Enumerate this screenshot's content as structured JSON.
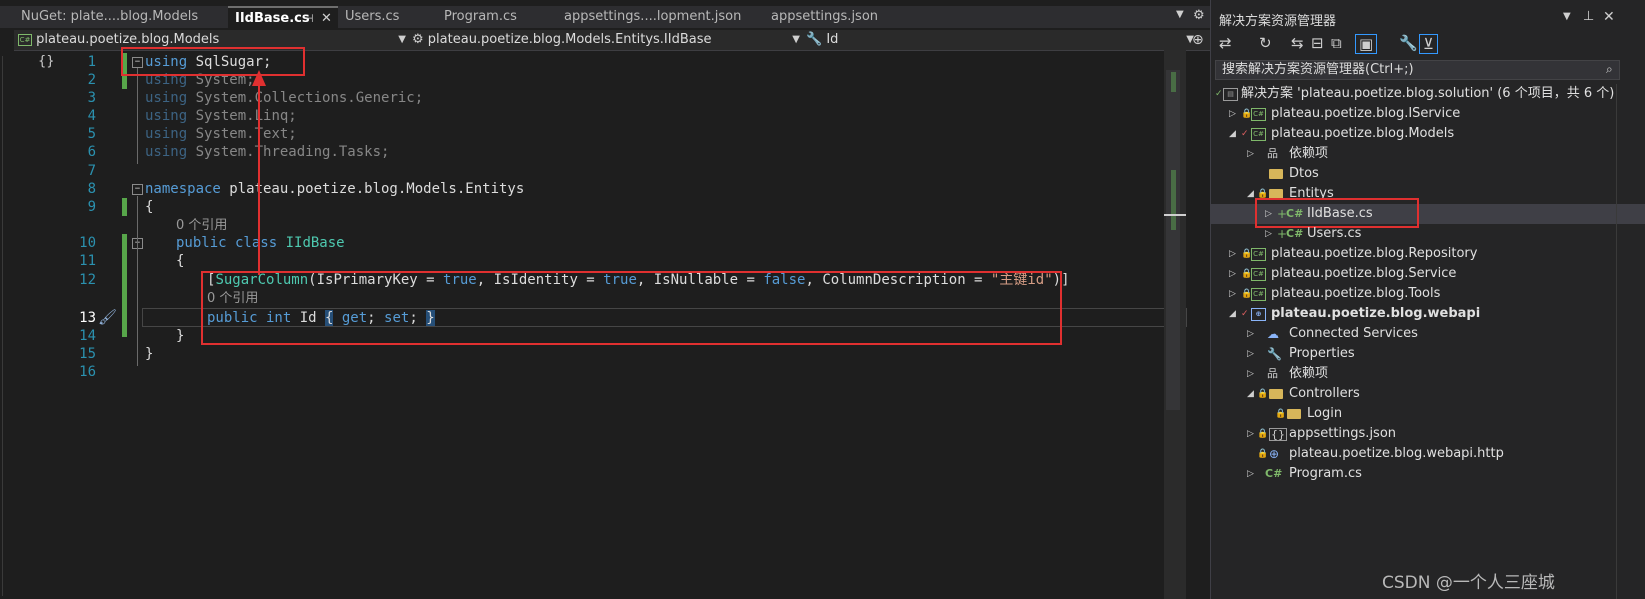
{
  "tabs": [
    {
      "label": "NuGet: plate....blog.Models"
    },
    {
      "label": "IIdBase.cs",
      "active": true
    },
    {
      "label": "Users.cs"
    },
    {
      "label": "Program.cs"
    },
    {
      "label": "appsettings....lopment.json"
    },
    {
      "label": "appsettings.json"
    }
  ],
  "navbar": {
    "project": "plateau.poetize.blog.Models",
    "type": "plateau.poetize.blog.Models.Entitys.IIdBase",
    "member": "Id"
  },
  "editor": {
    "current_line": 13,
    "lines": [
      {
        "n": "1"
      },
      {
        "n": "2"
      },
      {
        "n": "3"
      },
      {
        "n": "4"
      },
      {
        "n": "5"
      },
      {
        "n": "6"
      },
      {
        "n": "7"
      },
      {
        "n": "8"
      },
      {
        "n": "9"
      },
      {
        "n": "10"
      },
      {
        "n": "11"
      },
      {
        "n": "12"
      },
      {
        "n": "13"
      },
      {
        "n": "14"
      },
      {
        "n": "15"
      },
      {
        "n": "16"
      }
    ],
    "code": {
      "l1_kw": "using",
      "l1_ns": " SqlSugar;",
      "l2_kw": "using",
      "l2_ns": " System;",
      "l3_kw": "using",
      "l3_ns": " System.Collections.Generic;",
      "l4_kw": "using",
      "l4_ns": " System.Linq;",
      "l5_kw": "using",
      "l5_ns": " System.Text;",
      "l6_kw": "using",
      "l6_ns": " System.Threading.Tasks;",
      "l8_kw": "namespace",
      "l8_ns": " plateau.poetize.blog.Models.Entitys",
      "l9": "{",
      "ref1": "0 个引用",
      "l10_kw": "public class",
      "l10_type": " IIdBase",
      "l11": "{",
      "l12_open": "[",
      "l12_attr": "SugarColumn",
      "l12_a": "(IsPrimaryKey = ",
      "l12_true1": "true",
      "l12_b": ", IsIdentity = ",
      "l12_true2": "true",
      "l12_c": ", IsNullable = ",
      "l12_false": "false",
      "l12_d": ", ColumnDescription = ",
      "l12_str": "\"主键id\"",
      "l12_close": ")]",
      "ref2": "0 个引用",
      "l13_kw": "public int",
      "l13_name": " Id ",
      "l13_ob": "{",
      "l13_get": " get",
      "l13_semi1": "; ",
      "l13_set": "set",
      "l13_semi2": "; ",
      "l13_cb": "}",
      "l14": "}",
      "l15": "}"
    }
  },
  "solution_explorer": {
    "title": "解决方案资源管理器",
    "search_placeholder": "搜索解决方案资源管理器(Ctrl+;)",
    "items": [
      {
        "label": "解决方案 'plateau.poetize.blog.solution' (6 个项目，共 6 个)",
        "icon": "solution-icon"
      },
      {
        "label": "plateau.poetize.blog.IService",
        "icon": "csproj-icon"
      },
      {
        "label": "plateau.poetize.blog.Models",
        "icon": "csproj-icon"
      },
      {
        "label": "依赖项",
        "icon": "dependencies-icon"
      },
      {
        "label": "Dtos",
        "icon": "folder-icon"
      },
      {
        "label": "Entitys",
        "icon": "folder-icon"
      },
      {
        "label": "IIdBase.cs",
        "icon": "csharp-file-icon",
        "selected": true
      },
      {
        "label": "Users.cs",
        "icon": "csharp-file-icon"
      },
      {
        "label": "plateau.poetize.blog.Repository",
        "icon": "csproj-icon"
      },
      {
        "label": "plateau.poetize.blog.Service",
        "icon": "csproj-icon"
      },
      {
        "label": "plateau.poetize.blog.Tools",
        "icon": "csproj-icon"
      },
      {
        "label": "plateau.poetize.blog.webapi",
        "icon": "webproj-icon"
      },
      {
        "label": "Connected Services",
        "icon": "connected-services-icon"
      },
      {
        "label": "Properties",
        "icon": "properties-icon"
      },
      {
        "label": "依赖项",
        "icon": "dependencies-icon"
      },
      {
        "label": "Controllers",
        "icon": "folder-icon"
      },
      {
        "label": "Login",
        "icon": "folder-icon"
      },
      {
        "label": "appsettings.json",
        "icon": "json-file-icon"
      },
      {
        "label": "plateau.poetize.blog.webapi.http",
        "icon": "http-file-icon"
      },
      {
        "label": "Program.cs",
        "icon": "csharp-file-icon"
      }
    ]
  },
  "watermark": "CSDN @一个人三座城",
  "colors": {
    "keyword": "#569cd6",
    "type": "#4ec9b0",
    "string": "#d69d85",
    "line_number": "#2b91af",
    "highlight_box": "#e03030",
    "change_bar": "#57a64a"
  }
}
